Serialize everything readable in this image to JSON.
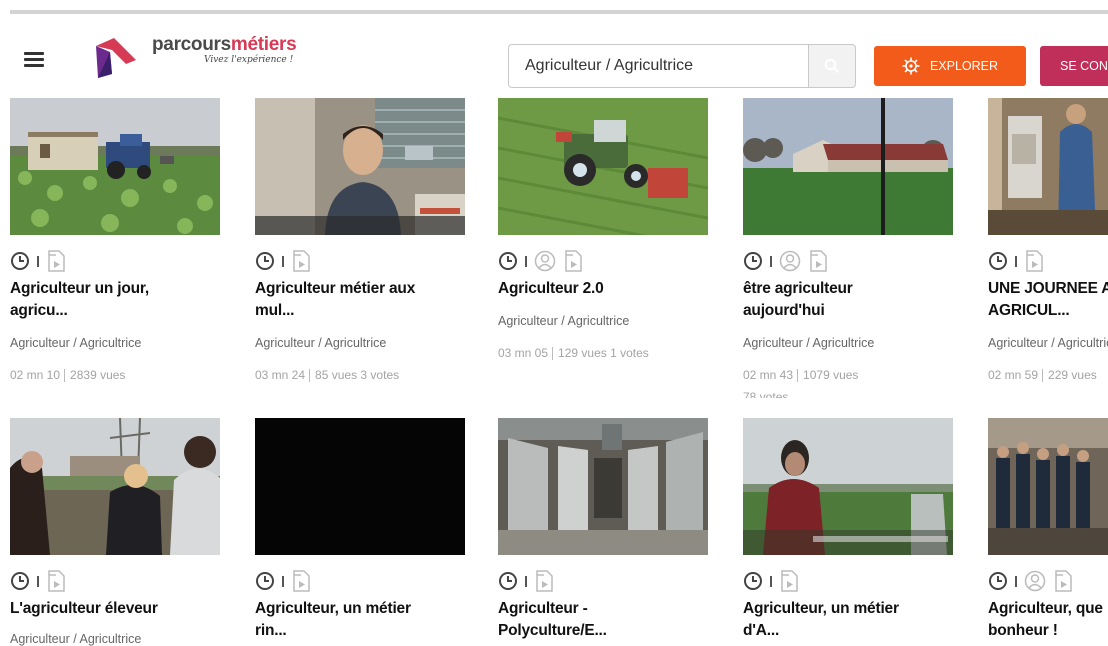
{
  "header": {
    "logo_prefix": "parcours",
    "logo_suffix": "métiers",
    "logo_tagline": "Vivez l'expérience !",
    "search_value": "Agriculteur / Agricultrice",
    "explore_label": "EXPLORER",
    "login_label": "SE CON"
  },
  "icons": {
    "menu": "hamburger-icon",
    "search": "search-icon",
    "explore": "compass-gear-icon",
    "clock": "clock-icon",
    "user": "user-icon",
    "video": "video-file-icon"
  },
  "colors": {
    "explore_button": "#f25b1a",
    "login_button": "#bf2f5a",
    "logo_accent": "#d73a55"
  },
  "videos": [
    {
      "title_l1": "Agriculteur un jour,",
      "title_l2": "agricu...",
      "category": "Agriculteur / Agricultrice",
      "duration": "02 mn 10",
      "views": "2839 vues",
      "votes": ""
    },
    {
      "title_l1": "Agriculteur métier aux",
      "title_l2": "mul...",
      "category": "Agriculteur / Agricultrice",
      "duration": "03 mn 24",
      "views": "85 vues",
      "votes": "3 votes"
    },
    {
      "title_l1": "Agriculteur 2.0",
      "title_l2": "",
      "category": "Agriculteur / Agricultrice",
      "duration": "03 mn 05",
      "views": "129 vues",
      "votes": "1 votes"
    },
    {
      "title_l1": "être agriculteur",
      "title_l2": "aujourd'hui",
      "category": "Agriculteur / Agricultrice",
      "duration": "02 mn 43",
      "views": "1079 vues",
      "votes": "78 votes"
    },
    {
      "title_l1": "UNE JOURNEE A",
      "title_l2": "AGRICUL...",
      "category": "Agriculteur / Agricultrice",
      "duration": "02 mn 59",
      "views": "229 vues",
      "votes": ""
    },
    {
      "title_l1": "L'agriculteur éleveur",
      "title_l2": "",
      "category": "Agriculteur / Agricultrice"
    },
    {
      "title_l1": "Agriculteur, un métier",
      "title_l2": "rin..."
    },
    {
      "title_l1": "Agriculteur -",
      "title_l2": "Polyculture/E..."
    },
    {
      "title_l1": "Agriculteur, un métier",
      "title_l2": "d'A..."
    },
    {
      "title_l1": "Agriculteur, que",
      "title_l2": "bonheur !"
    }
  ]
}
